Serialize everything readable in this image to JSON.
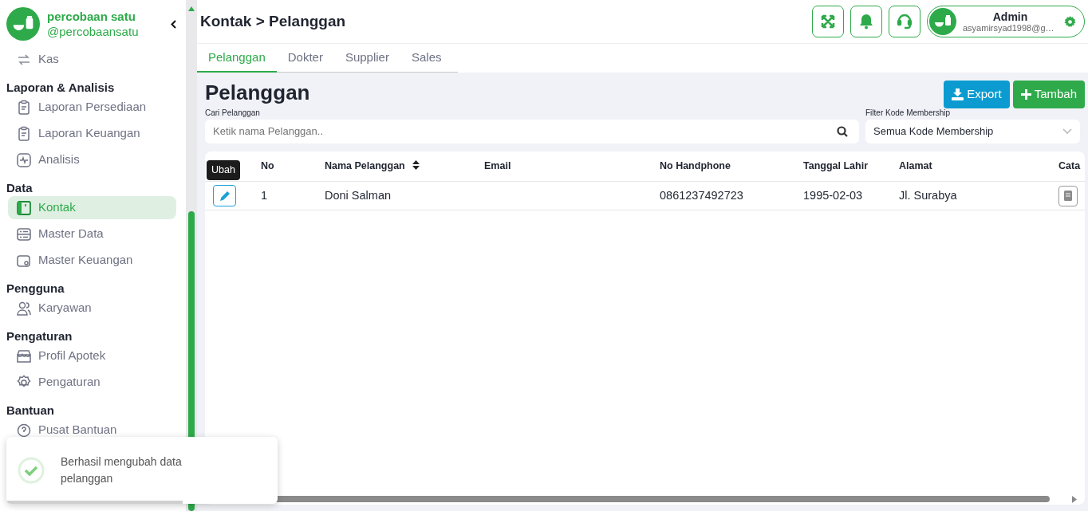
{
  "sidebar": {
    "brand": {
      "name": "percobaan satu",
      "handle": "@percobaansatu"
    },
    "groups": [
      {
        "items": [
          {
            "label": "Kas",
            "selected": false
          }
        ]
      },
      {
        "title": "Laporan & Analisis",
        "items": [
          {
            "label": "Laporan Persediaan",
            "selected": false
          },
          {
            "label": "Laporan Keuangan",
            "selected": false
          },
          {
            "label": "Analisis",
            "selected": false
          }
        ]
      },
      {
        "title": "Data",
        "items": [
          {
            "label": "Kontak",
            "selected": true
          },
          {
            "label": "Master Data",
            "selected": false
          },
          {
            "label": "Master Keuangan",
            "selected": false
          }
        ]
      },
      {
        "title": "Pengguna",
        "items": [
          {
            "label": "Karyawan",
            "selected": false
          }
        ]
      },
      {
        "title": "Pengaturan",
        "items": [
          {
            "label": "Profil Apotek",
            "selected": false
          },
          {
            "label": "Pengaturan",
            "selected": false
          }
        ]
      },
      {
        "title": "Bantuan",
        "items": [
          {
            "label": "Pusat Bantuan",
            "selected": false
          }
        ]
      }
    ]
  },
  "header": {
    "breadcrumb": "Kontak > Pelanggan",
    "user": {
      "name": "Admin",
      "email": "asyamirsyad1998@g…"
    }
  },
  "tabs": [
    {
      "label": "Pelanggan",
      "selected": true
    },
    {
      "label": "Dokter",
      "selected": false
    },
    {
      "label": "Supplier",
      "selected": false
    },
    {
      "label": "Sales",
      "selected": false
    }
  ],
  "page": {
    "title": "Pelanggan",
    "buttons": [
      {
        "label": "Export",
        "kind": "export"
      },
      {
        "label": "Tambah",
        "kind": "add"
      }
    ],
    "search": {
      "label": "Cari Pelanggan",
      "placeholder": "Ketik nama Pelanggan.."
    },
    "filter": {
      "label": "Filter Kode Membership",
      "value": "Semua Kode Membership"
    }
  },
  "table": {
    "columns": [
      {
        "kind": "options"
      },
      {
        "kind": "text",
        "label": "No"
      },
      {
        "kind": "sortable",
        "label": "Nama Pelanggan"
      },
      {
        "kind": "text",
        "label": "Email"
      },
      {
        "kind": "text",
        "label": "No Handphone"
      },
      {
        "kind": "text",
        "label": "Tanggal Lahir"
      },
      {
        "kind": "text",
        "label": "Alamat"
      },
      {
        "kind": "note",
        "label": "Cata"
      }
    ],
    "rows": [
      {
        "edit_tooltip": "Ubah",
        "cells": [
          "",
          "1",
          "Doni Salman",
          "",
          "0861237492723",
          "1995-02-03",
          "Jl. Surabya",
          ""
        ]
      }
    ]
  },
  "toast": {
    "message": "Berhasil mengubah data pelanggan",
    "level": 0.65
  }
}
